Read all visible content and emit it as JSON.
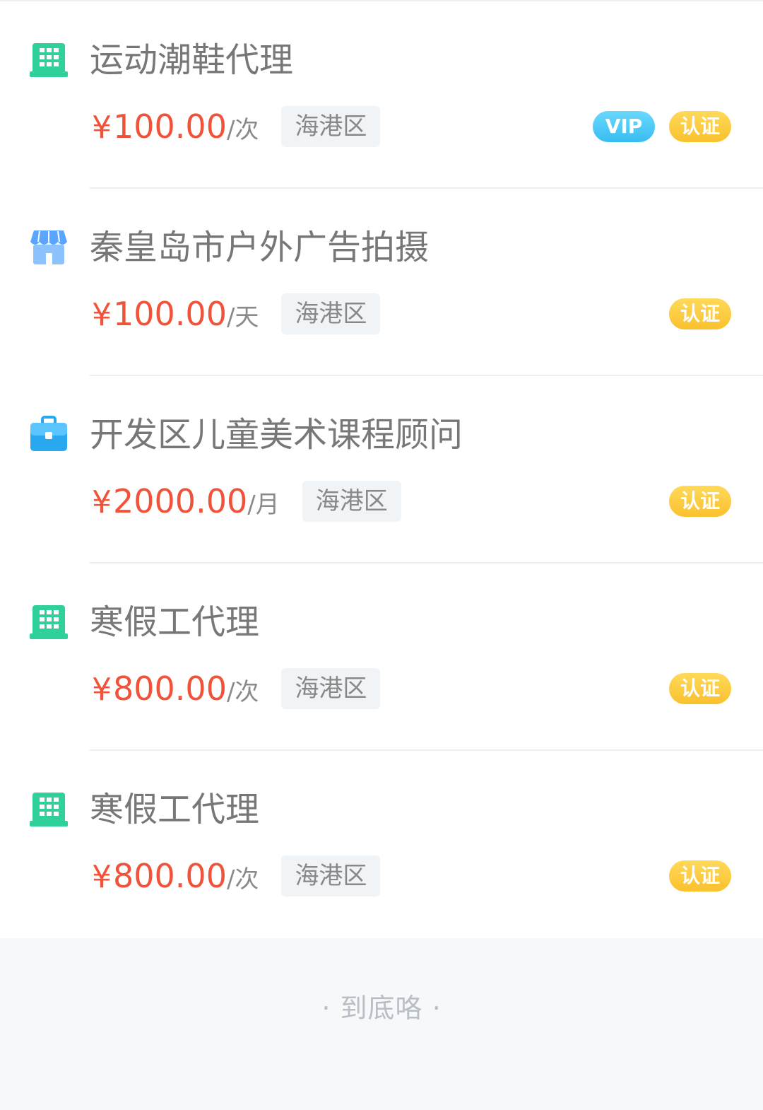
{
  "listings": [
    {
      "icon": "building-icon",
      "title": "运动潮鞋代理",
      "currency": "¥",
      "amount": "100.00",
      "unit": "/次",
      "district": "海港区",
      "vip_label": "VIP",
      "cert_label": "认证"
    },
    {
      "icon": "store-icon",
      "title": "秦皇岛市户外广告拍摄",
      "currency": "¥",
      "amount": "100.00",
      "unit": "/天",
      "district": "海港区",
      "cert_label": "认证"
    },
    {
      "icon": "briefcase-icon",
      "title": "开发区儿童美术课程顾问",
      "currency": "¥",
      "amount": "2000.00",
      "unit": "/月",
      "district": "海港区",
      "cert_label": "认证"
    },
    {
      "icon": "building-icon",
      "title": "寒假工代理",
      "currency": "¥",
      "amount": "800.00",
      "unit": "/次",
      "district": "海港区",
      "cert_label": "认证"
    },
    {
      "icon": "building-icon",
      "title": "寒假工代理",
      "currency": "¥",
      "amount": "800.00",
      "unit": "/次",
      "district": "海港区",
      "cert_label": "认证"
    }
  ],
  "footer": {
    "end_text": "· 到底咯 ·"
  },
  "colors": {
    "price": "#f0533a",
    "building_icon": "#2fd09a",
    "store_icon": "#5aa6ff",
    "briefcase_icon": "#2aa8ef",
    "vip_badge": "#45c6f5",
    "cert_badge": "#fbc93c"
  }
}
